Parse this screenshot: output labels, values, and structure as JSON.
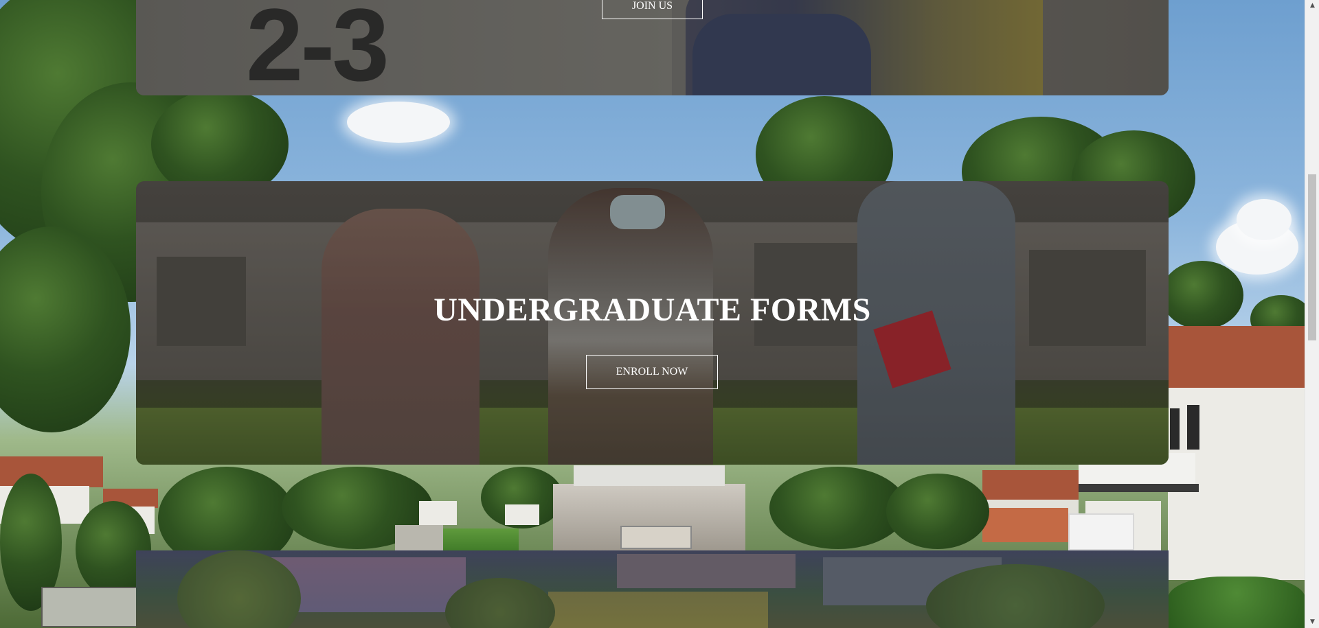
{
  "cards": {
    "join": {
      "button_label": "JOIN US"
    },
    "undergraduate": {
      "title": "UNDERGRADUATE FORMS",
      "button_label": "ENROLL NOW"
    }
  },
  "photo_text": {
    "numerals": "2-3"
  },
  "scrollbar": {
    "up_arrow": "▲",
    "down_arrow": "▼"
  },
  "colors": {
    "card_overlay": "#5e5b57",
    "button_border": "#ffffff",
    "title_text": "#ffffff"
  }
}
